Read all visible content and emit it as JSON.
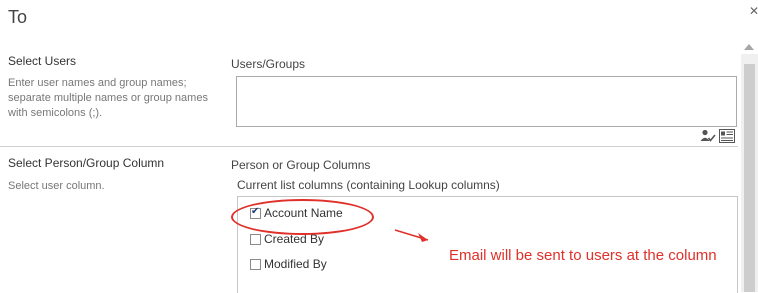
{
  "dialog": {
    "title": "To"
  },
  "select_users": {
    "heading": "Select Users",
    "description": "Enter user names and group names; separate multiple names or group names with semicolons (;).",
    "field_label": "Users/Groups",
    "value": ""
  },
  "person_group": {
    "heading": "Select Person/Group Column",
    "description": "Select user column.",
    "field_label": "Person or Group Columns",
    "sub_label": "Current list columns (containing Lookup columns)",
    "columns": [
      {
        "label": "Account Name",
        "checked": true
      },
      {
        "label": "Created By",
        "checked": false
      },
      {
        "label": "Modified By",
        "checked": false
      }
    ]
  },
  "annotation": {
    "text": "Email will be sent to users at the column",
    "color": "#e0302a"
  },
  "icons": {
    "close": "close-icon",
    "people": "check-names-icon",
    "browse": "address-book-icon"
  }
}
